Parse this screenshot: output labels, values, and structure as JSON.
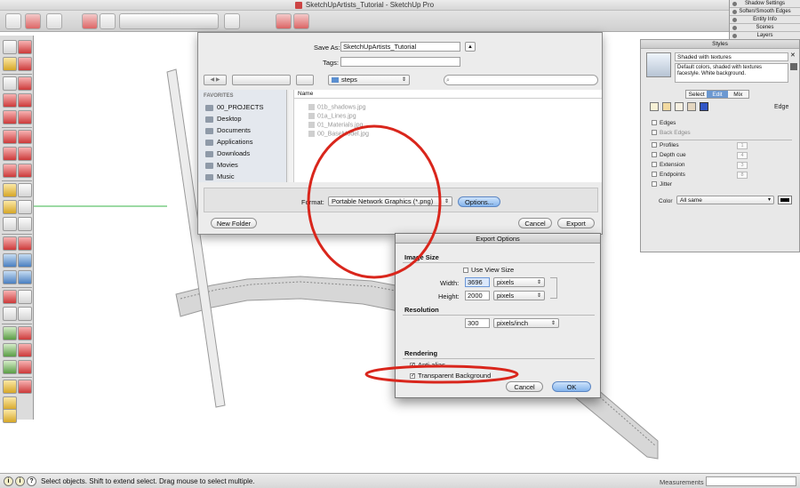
{
  "window": {
    "title": "SketchUpArtists_Tutorial - SketchUp Pro"
  },
  "tray": {
    "items": [
      "Shadow Settings",
      "Soften/Smooth Edges",
      "Entity Info",
      "Scenes",
      "Layers"
    ]
  },
  "styles_panel": {
    "title": "Styles",
    "style_name": "Shaded with textures",
    "style_desc": "Default colors, shaded with textures facestyle. White background.",
    "tabs": [
      "Select",
      "Edit",
      "Mix"
    ],
    "section": "Edge",
    "options": [
      {
        "label": "Edges",
        "checked": false,
        "value": ""
      },
      {
        "label": "Back Edges",
        "checked": false,
        "value": ""
      },
      {
        "label": "Profiles",
        "checked": false,
        "value": "1"
      },
      {
        "label": "Depth cue",
        "checked": false,
        "value": "4"
      },
      {
        "label": "Extension",
        "checked": false,
        "value": "3"
      },
      {
        "label": "Endpoints",
        "checked": false,
        "value": "8"
      },
      {
        "label": "Jitter",
        "checked": false,
        "value": ""
      }
    ],
    "color_label": "Color",
    "color_value": "All same",
    "swatch_color": "#000000"
  },
  "save_dialog": {
    "save_as_label": "Save As:",
    "save_as_value": "SketchUpArtists_Tutorial",
    "tags_label": "Tags:",
    "tags_value": "",
    "folder": "steps",
    "search_placeholder": "",
    "favorites_label": "FAVORITES",
    "favorites": [
      "00_PROJECTS",
      "Desktop",
      "Documents",
      "Applications",
      "Downloads",
      "Movies",
      "Music"
    ],
    "name_header": "Name",
    "files": [
      "01b_shadows.jpg",
      "01a_Lines.jpg",
      "01_Materials.jpg",
      "00_BaseModel.jpg"
    ],
    "format_label": "Format:",
    "format_value": "Portable Network Graphics (*.png)",
    "options_button": "Options...",
    "new_folder_button": "New Folder",
    "cancel_button": "Cancel",
    "export_button": "Export"
  },
  "export_options": {
    "title": "Export Options",
    "image_size_label": "Image Size",
    "use_view_size_label": "Use View Size",
    "use_view_size_checked": false,
    "width_label": "Width:",
    "width_value": "3696",
    "width_unit": "pixels",
    "height_label": "Height:",
    "height_value": "2000",
    "height_unit": "pixels",
    "resolution_label": "Resolution",
    "resolution_value": "300",
    "resolution_unit": "pixels/inch",
    "rendering_label": "Rendering",
    "anti_alias_label": "Anti-alias",
    "anti_alias_checked": true,
    "transparent_label": "Transparent Background",
    "transparent_checked": true,
    "cancel_button": "Cancel",
    "ok_button": "OK"
  },
  "annotation_color": "#d9261c",
  "status": {
    "text": "Select objects. Shift to extend select. Drag mouse to select multiple.",
    "measurements_label": "Measurements",
    "measurements_value": ""
  }
}
